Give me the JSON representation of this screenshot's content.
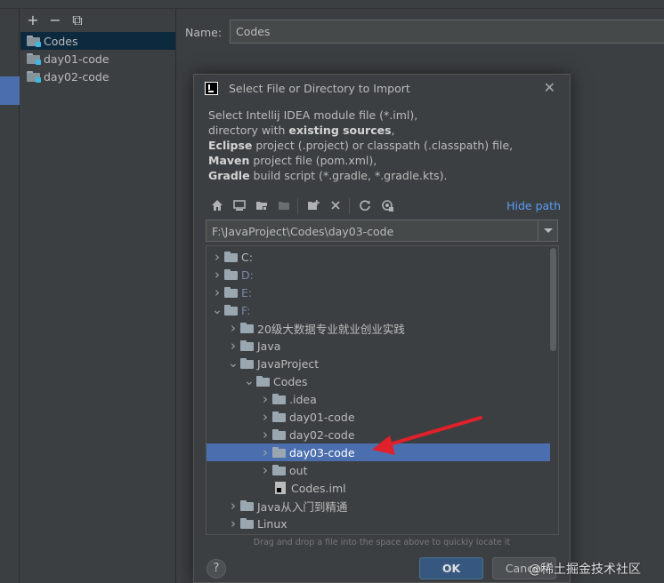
{
  "modules_panel": {
    "toolbar": [
      "+",
      "−",
      "⧉"
    ],
    "items": [
      {
        "label": "Codes",
        "selected": true
      },
      {
        "label": "day01-code",
        "selected": false
      },
      {
        "label": "day02-code",
        "selected": false
      }
    ]
  },
  "module_settings": {
    "name_label": "Name:",
    "name_value": "Codes"
  },
  "dialog": {
    "title": "Select File or Directory to Import",
    "description": {
      "line1": "Select Intellij IDEA module file (*.iml),",
      "line2_a": "directory with ",
      "line2_b": "existing sources",
      "line2_c": ",",
      "line3_a": "Eclipse",
      "line3_b": " project (.project) or classpath (.classpath) file,",
      "line4_a": "Maven",
      "line4_b": " project file (pom.xml),",
      "line5_a": "Gradle",
      "line5_b": " build script (*.gradle, *.gradle.kts)."
    },
    "toolbar": {
      "icons": [
        "home-icon",
        "desktop-icon",
        "project-folder-icon",
        "module-folder-icon",
        "new-folder-icon",
        "delete-icon",
        "refresh-icon",
        "show-hidden-icon"
      ],
      "hide_path": "Hide path"
    },
    "path": "F:\\JavaProject\\Codes\\day03-code",
    "tree": [
      {
        "label": "C:",
        "depth": 0,
        "expanded": false,
        "dim": false,
        "type": "drive"
      },
      {
        "label": "D:",
        "depth": 0,
        "expanded": false,
        "dim": true,
        "type": "drive"
      },
      {
        "label": "E:",
        "depth": 0,
        "expanded": false,
        "dim": true,
        "type": "drive"
      },
      {
        "label": "F:",
        "depth": 0,
        "expanded": true,
        "dim": true,
        "type": "drive"
      },
      {
        "label": "20级大数据专业就业创业实践",
        "depth": 1,
        "expanded": false,
        "type": "folder"
      },
      {
        "label": "Java",
        "depth": 1,
        "expanded": false,
        "type": "folder"
      },
      {
        "label": "JavaProject",
        "depth": 1,
        "expanded": true,
        "type": "folder"
      },
      {
        "label": "Codes",
        "depth": 2,
        "expanded": true,
        "type": "folder"
      },
      {
        "label": ".idea",
        "depth": 3,
        "expanded": false,
        "type": "folder"
      },
      {
        "label": "day01-code",
        "depth": 3,
        "expanded": false,
        "type": "folder"
      },
      {
        "label": "day02-code",
        "depth": 3,
        "expanded": false,
        "type": "folder"
      },
      {
        "label": "day03-code",
        "depth": 3,
        "expanded": false,
        "type": "folder",
        "selected": true
      },
      {
        "label": "out",
        "depth": 3,
        "expanded": false,
        "type": "folder"
      },
      {
        "label": "Codes.iml",
        "depth": 3,
        "type": "file"
      },
      {
        "label": "Java从入门到精通",
        "depth": 1,
        "expanded": false,
        "type": "folder"
      },
      {
        "label": "Linux",
        "depth": 1,
        "expanded": false,
        "type": "folder"
      }
    ],
    "drag_hint": "Drag and drop a file into the space above to quickly locate it",
    "help": "?",
    "ok": "OK",
    "cancel": "Cancel"
  },
  "watermark": "@稀土掘金技术社区",
  "colors": {
    "background": "#3c3f41",
    "selection": "#4b6eaf",
    "link": "#589df6",
    "ok_button": "#365880",
    "annotation_arrow": "#e0202a"
  }
}
